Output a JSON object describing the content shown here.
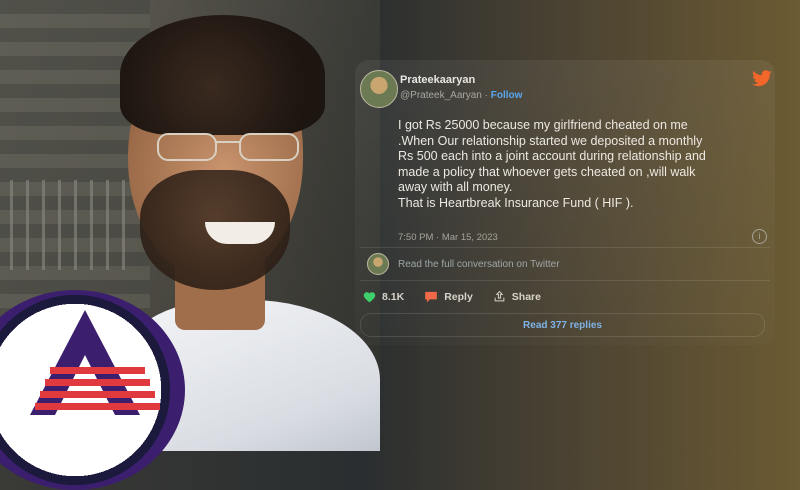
{
  "tweet": {
    "display_name": "Prateekaaryan",
    "handle": "@Prateek_Aaryan",
    "separator": "·",
    "follow_label": "Follow",
    "text": "I got Rs 25000 because my girlfriend cheated on me\n.When Our relationship started we deposited a monthly\nRs 500 each into a joint account during relationship and\nmade a policy that whoever gets cheated on ,will walk\naway with all money.\nThat is Heartbreak Insurance Fund ( HIF ).",
    "timestamp": "7:50 PM · Mar 15, 2023",
    "full_conversation_label": "Read the full conversation on Twitter",
    "likes_count": "8.1K",
    "reply_label": "Reply",
    "share_label": "Share",
    "read_replies_label": "Read 377 replies"
  },
  "icons": {
    "bird": "twitter-bird-icon",
    "info": "info-icon",
    "heart": "heart-icon",
    "reply": "reply-bubble-icon",
    "share": "share-icon"
  },
  "colors": {
    "accent_blue": "#5aa7f0",
    "heart_green": "#3ecf6a",
    "reply_orange": "#f06a4a",
    "bird_orange": "#f2662a",
    "logo_purple": "#3b1e6e",
    "logo_red": "#e0393e"
  }
}
